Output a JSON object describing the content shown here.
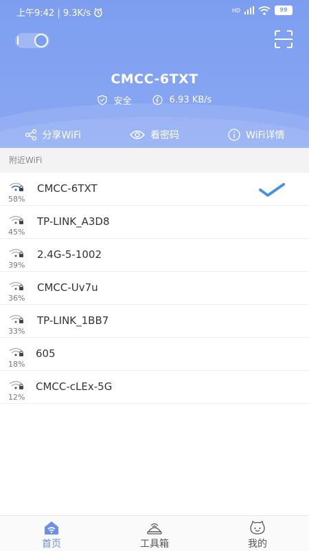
{
  "status_bar": {
    "time_speed": "上午9:42 | 9.3K/s",
    "hd": "HD",
    "battery": "99"
  },
  "header": {
    "ssid": "CMCC-6TXT",
    "security": "安全",
    "speed": "6.93 KB/s",
    "actions": {
      "share": "分享WiFi",
      "password": "看密码",
      "details": "WiFi详情"
    }
  },
  "nearby": {
    "title": "附近WiFi",
    "networks": [
      {
        "name": "CMCC-6TXT",
        "signal": "58%",
        "locked": true,
        "connected": true
      },
      {
        "name": "TP-LINK_A3D8",
        "signal": "45%",
        "locked": true,
        "connected": false
      },
      {
        "name": "2.4G-5-1002",
        "signal": "39%",
        "locked": true,
        "connected": false
      },
      {
        "name": "CMCC-Uv7u",
        "signal": "36%",
        "locked": true,
        "connected": false
      },
      {
        "name": "TP-LINK_1BB7",
        "signal": "33%",
        "locked": true,
        "connected": false
      },
      {
        "name": "605",
        "signal": "18%",
        "locked": true,
        "connected": false
      },
      {
        "name": "CMCC-cLEx-5G",
        "signal": "12%",
        "locked": true,
        "connected": false
      }
    ]
  },
  "bottom_nav": {
    "home": "首页",
    "toolbox": "工具箱",
    "mine": "我的"
  },
  "colors": {
    "accent": "#6d8fea",
    "header_bg": "#7d9ef0",
    "check": "#4a90e2"
  }
}
